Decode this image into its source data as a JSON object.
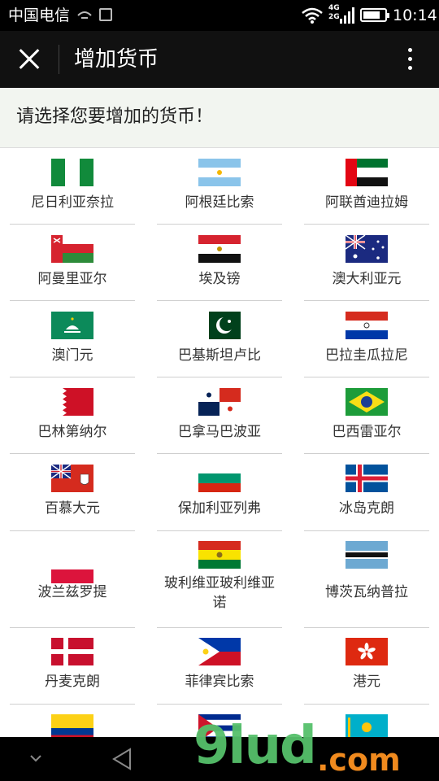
{
  "status_bar": {
    "carrier": "中国电信",
    "net_top": "4G",
    "net_bottom": "2G",
    "battery_level": 0.8,
    "time": "10:14"
  },
  "title_bar": {
    "title": "增加货币",
    "close_icon": "close-icon",
    "more_icon": "more-vertical-icon"
  },
  "prompt": "请选择您要增加的货币！",
  "currencies": [
    {
      "name": "尼日利亚奈拉",
      "flag": "nigeria"
    },
    {
      "name": "阿根廷比索",
      "flag": "argentina"
    },
    {
      "name": "阿联酋迪拉姆",
      "flag": "uae"
    },
    {
      "name": "阿曼里亚尔",
      "flag": "oman"
    },
    {
      "name": "埃及镑",
      "flag": "egypt"
    },
    {
      "name": "澳大利亚元",
      "flag": "australia"
    },
    {
      "name": "澳门元",
      "flag": "macau"
    },
    {
      "name": "巴基斯坦卢比",
      "flag": "pakistan"
    },
    {
      "name": "巴拉圭瓜拉尼",
      "flag": "paraguay"
    },
    {
      "name": "巴林第纳尔",
      "flag": "bahrain"
    },
    {
      "name": "巴拿马巴波亚",
      "flag": "panama"
    },
    {
      "name": "巴西雷亚尔",
      "flag": "brazil"
    },
    {
      "name": "百慕大元",
      "flag": "bermuda"
    },
    {
      "name": "保加利亚列弗",
      "flag": "bulgaria"
    },
    {
      "name": "冰岛克朗",
      "flag": "iceland"
    },
    {
      "name": "波兰兹罗提",
      "flag": "poland"
    },
    {
      "name": "玻利维亚玻利维亚诺",
      "flag": "bolivia"
    },
    {
      "name": "博茨瓦纳普拉",
      "flag": "botswana"
    },
    {
      "name": "丹麦克朗",
      "flag": "denmark"
    },
    {
      "name": "菲律宾比索",
      "flag": "philippines"
    },
    {
      "name": "港元",
      "flag": "hongkong"
    },
    {
      "name": "",
      "flag": "colombia"
    },
    {
      "name": "",
      "flag": "cuba"
    },
    {
      "name": "",
      "flag": "kazakhstan"
    }
  ],
  "nav_bar": {
    "back_icon": "back-triangle-icon",
    "down_icon": "chevron-down-icon"
  },
  "watermark": {
    "brand_a": "9lud",
    "brand_b": ".com"
  }
}
